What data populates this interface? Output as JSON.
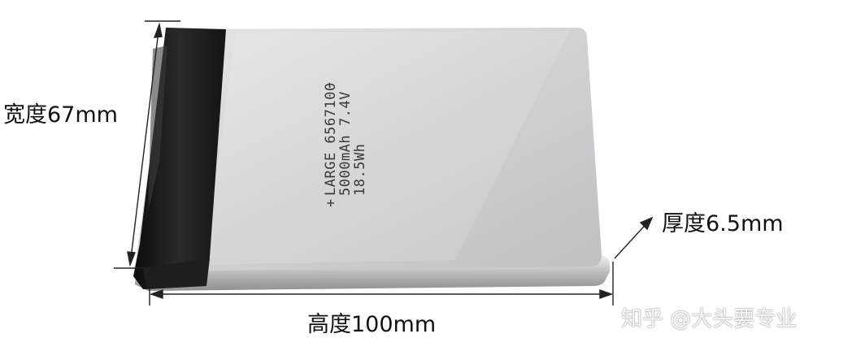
{
  "dimensions": {
    "width_label": "宽度67mm",
    "thickness_label": "厚度6.5mm",
    "height_label": "高度100mm"
  },
  "battery_print": {
    "polarity": "+",
    "minus": "-",
    "line1": "LARGE 6567100",
    "line2": "5000mAh 7.4V",
    "line3": "18.5Wh"
  },
  "watermark": "知乎 @大头要专业",
  "colors": {
    "cell_body": "#d4d5d7",
    "tape": "#161616",
    "label_text": "#111111"
  }
}
